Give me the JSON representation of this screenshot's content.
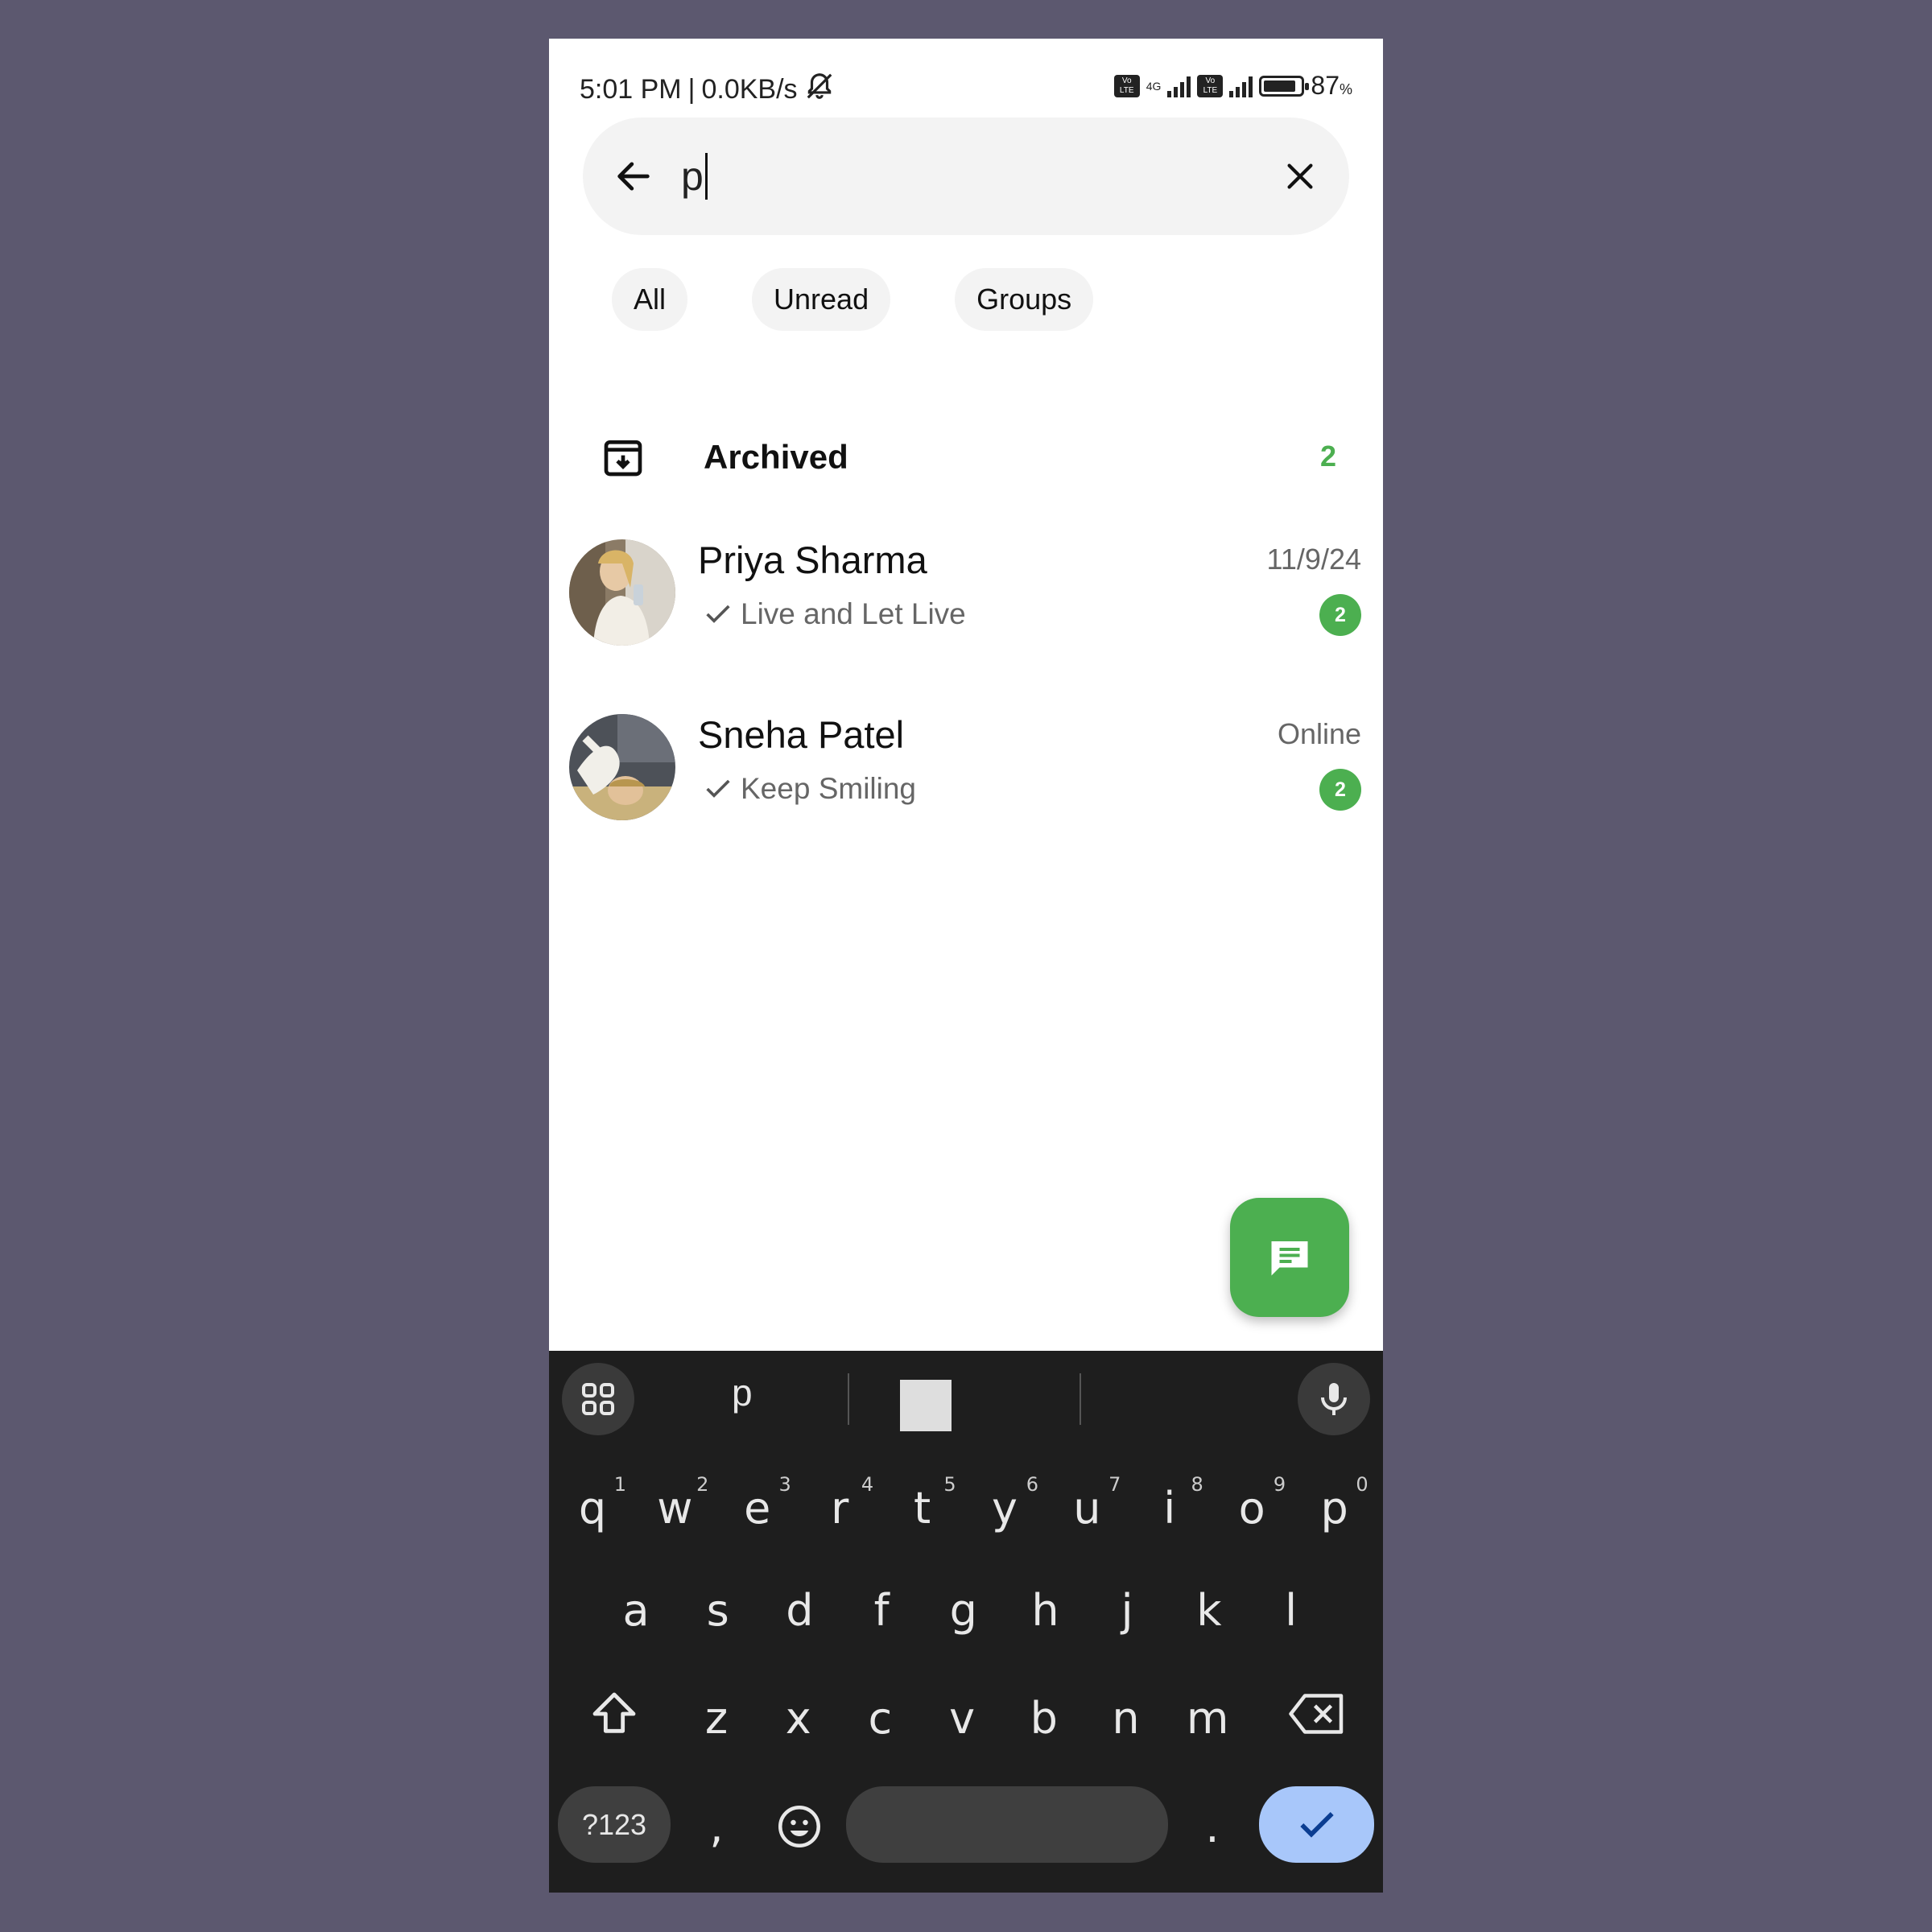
{
  "status_bar": {
    "time": "5:01 PM",
    "separator": "|",
    "speed": "0.0KB/s",
    "network_label": "4G",
    "volte_label": "Vo LTE",
    "battery_percent": "87",
    "battery_percent_sign": "%",
    "battery_level": 0.87
  },
  "search": {
    "value": "p",
    "back_icon": "arrow-left-icon",
    "clear_icon": "close-icon"
  },
  "filters": {
    "chips": [
      "All",
      "Unread",
      "Groups"
    ]
  },
  "archived": {
    "label": "Archived",
    "count": "2",
    "icon": "archive-icon",
    "count_color": "#4caf50"
  },
  "chats": [
    {
      "name": "Priya Sharma",
      "preview": "Live and Let Live",
      "time": "11/9/24",
      "unread": "2"
    },
    {
      "name": "Sneha Patel",
      "preview": "Keep Smiling",
      "time": "Online",
      "unread": "2"
    }
  ],
  "fab": {
    "icon": "message-icon",
    "color": "#4caf50"
  },
  "keyboard": {
    "suggestion": "p",
    "row1": [
      "q",
      "w",
      "e",
      "r",
      "t",
      "y",
      "u",
      "i",
      "o",
      "p"
    ],
    "row1_sup": [
      "1",
      "2",
      "3",
      "4",
      "5",
      "6",
      "7",
      "8",
      "9",
      "0"
    ],
    "row2": [
      "a",
      "s",
      "d",
      "f",
      "g",
      "h",
      "j",
      "k",
      "l"
    ],
    "row3": [
      "z",
      "x",
      "c",
      "v",
      "b",
      "n",
      "m"
    ],
    "symbols_label": "?123",
    "comma": ",",
    "period": ".",
    "enter_color": "#a8c7fa"
  },
  "colors": {
    "background": "#5c586f",
    "accent_green": "#4caf50",
    "keyboard_bg": "#1e1e1e"
  }
}
